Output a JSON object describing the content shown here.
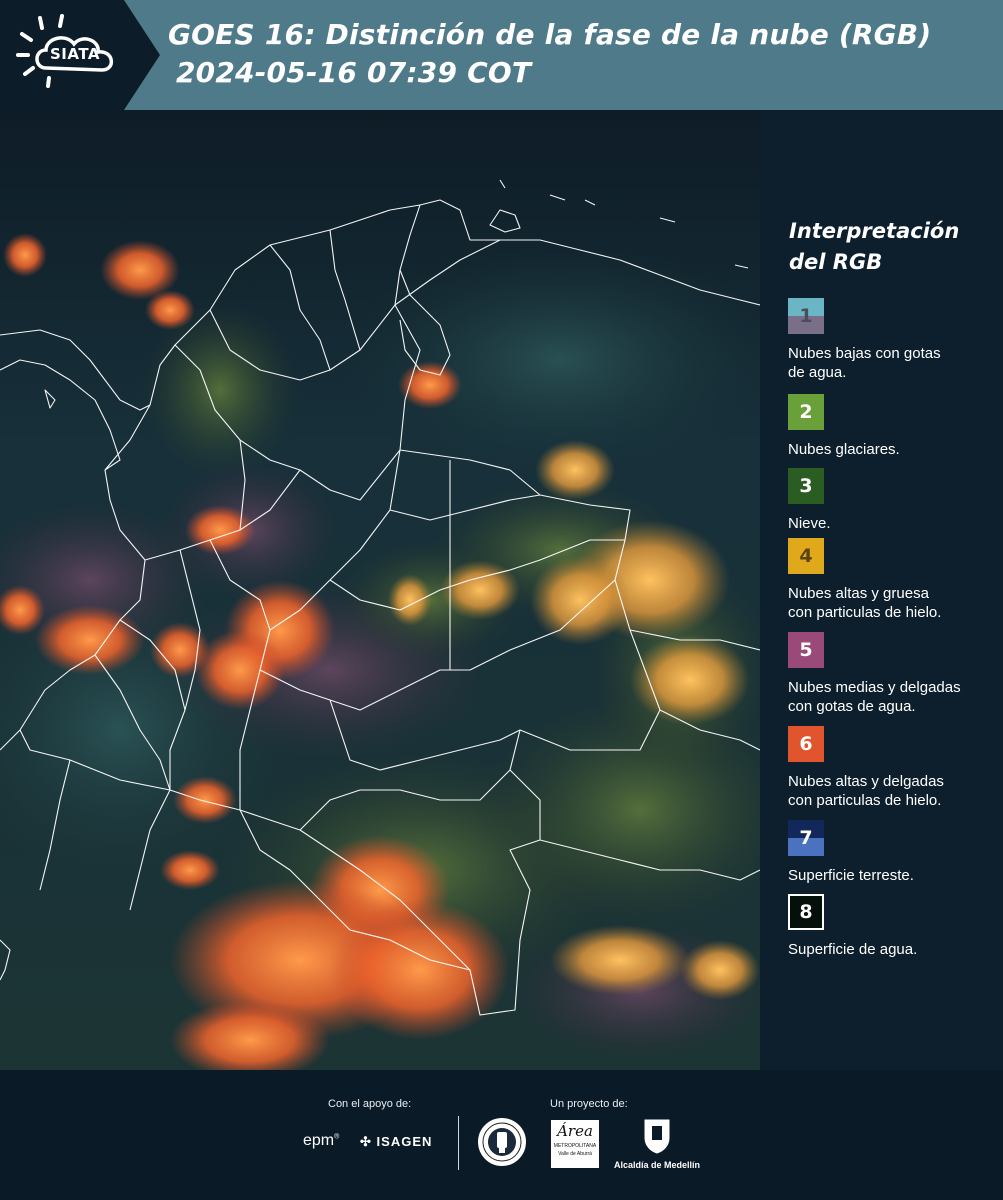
{
  "header": {
    "logo_text": "SIATA",
    "title_line1": "GOES 16: Distinción de la fase de la nube (RGB)",
    "title_line2": "2024-05-16 07:39 COT"
  },
  "legend": {
    "title_line1": "Interpretación",
    "title_line2": "del RGB",
    "items": [
      {
        "num": "1",
        "label_line1": "Nubes bajas con gotas",
        "label_line2": "de agua.",
        "color_top": "#6bb6c4",
        "color_bottom": "#7a6f89"
      },
      {
        "num": "2",
        "label_line1": "Nubes glaciares.",
        "label_line2": "",
        "color_top": "#6aa03a",
        "color_bottom": "#6aa03a"
      },
      {
        "num": "3",
        "label_line1": "Nieve.",
        "label_line2": "",
        "color_top": "#2b5d22",
        "color_bottom": "#2b5d22"
      },
      {
        "num": "4",
        "label_line1": "Nubes altas y gruesa",
        "label_line2": "con particulas de hielo.",
        "color_top": "#e0a91c",
        "color_bottom": "#e0a91c"
      },
      {
        "num": "5",
        "label_line1": "Nubes medias y delgadas",
        "label_line2": "con gotas de agua.",
        "color_top": "#9a4a78",
        "color_bottom": "#9a4a78"
      },
      {
        "num": "6",
        "label_line1": "Nubes altas y delgadas",
        "label_line2": "con particulas de hielo.",
        "color_top": "#e0552d",
        "color_bottom": "#e0552d"
      },
      {
        "num": "7",
        "label_line1": "Superficie terreste.",
        "label_line2": "",
        "color_top": "#12275a",
        "color_bottom": "#4a72bf"
      },
      {
        "num": "8",
        "label_line1": "Superficie de agua.",
        "label_line2": "",
        "color_top": "#05100a",
        "color_bottom": "#05100a"
      }
    ]
  },
  "footer": {
    "support_label": "Con el apoyo de:",
    "project_label": "Un proyecto de:",
    "epm": "epm",
    "isagen": "ISAGEN",
    "area_line1": "Área",
    "area_line2": "METROPOLITANA",
    "area_line3": "Valle de Aburrá",
    "alcaldia": "Alcaldía de Medellín"
  }
}
